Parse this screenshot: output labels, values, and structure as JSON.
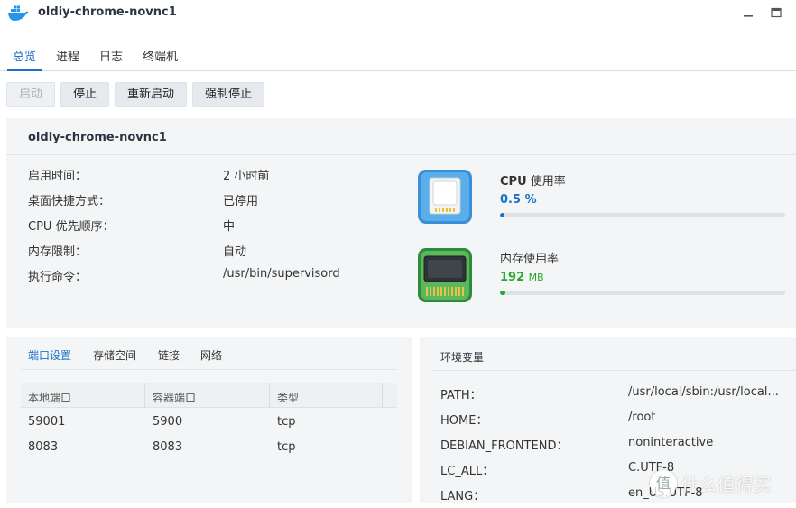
{
  "window": {
    "title": "oldiy-chrome-novnc1",
    "icon": "docker-whale-icon"
  },
  "tabs": [
    {
      "label": "总览",
      "active": true
    },
    {
      "label": "进程"
    },
    {
      "label": "日志"
    },
    {
      "label": "终端机"
    }
  ],
  "actions": {
    "start": "启动",
    "stop": "停止",
    "restart": "重新启动",
    "force_stop": "强制停止"
  },
  "overview": {
    "container_name": "oldiy-chrome-novnc1",
    "rows": [
      {
        "label": "启用时间：",
        "value": "2 小时前"
      },
      {
        "label": "桌面快捷方式：",
        "value": "已停用"
      },
      {
        "label": "CPU 优先顺序：",
        "value": "中"
      },
      {
        "label": "内存限制：",
        "value": "自动"
      },
      {
        "label": "执行命令：",
        "value": "/usr/bin/supervisord"
      }
    ],
    "cpu": {
      "label_bold": "CPU",
      "label_rest": " 使用率",
      "value": "0.5",
      "unit": "%",
      "fraction": 0.005,
      "color": "#1a73c7"
    },
    "memory": {
      "label": "内存使用率",
      "value": "192",
      "unit": "MB",
      "fraction": 0.02,
      "color": "#27a630"
    }
  },
  "settings": {
    "tabs": [
      "端口设置",
      "存储空间",
      "链接",
      "网络"
    ],
    "port_table": {
      "columns": [
        "本地端口",
        "容器端口",
        "类型"
      ],
      "rows": [
        [
          "59001",
          "5900",
          "tcp"
        ],
        [
          "8083",
          "8083",
          "tcp"
        ]
      ]
    }
  },
  "env": {
    "title": "环境变量",
    "rows": [
      {
        "key": "PATH：",
        "value": "/usr/local/sbin:/usr/local..."
      },
      {
        "key": "HOME：",
        "value": "/root"
      },
      {
        "key": "DEBIAN_FRONTEND：",
        "value": "noninteractive"
      },
      {
        "key": "LC_ALL：",
        "value": "C.UTF-8"
      },
      {
        "key": "LANG：",
        "value": "en_US.UTF-8"
      }
    ]
  },
  "watermark": {
    "glyph": "值",
    "text": "什么值得买"
  }
}
